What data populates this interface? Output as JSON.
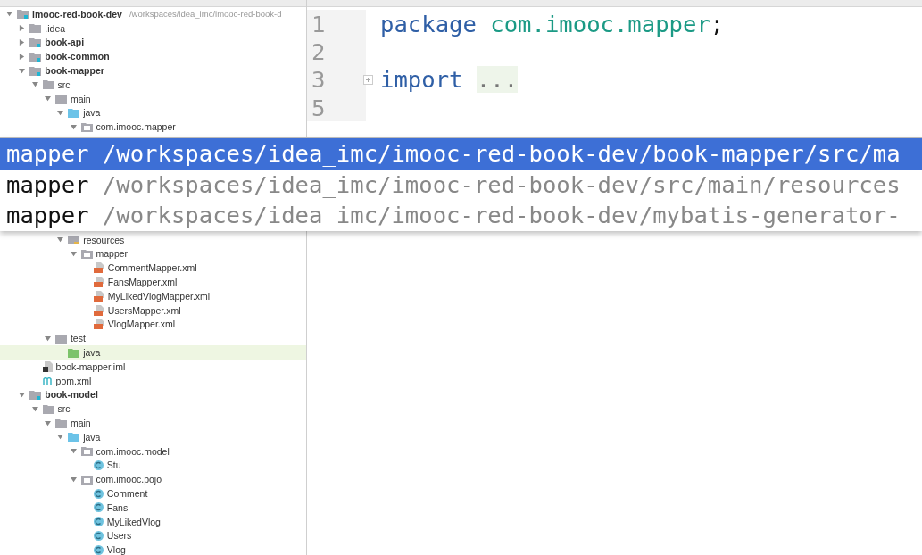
{
  "project_tree": [
    {
      "label": "imooc-red-book-dev",
      "path": "/workspaces/idea_imc/imooc-red-book-d",
      "kind": "module",
      "expanded": true,
      "selected": false,
      "children": [
        {
          "label": ".idea",
          "kind": "folder",
          "expanded": false,
          "selected": false
        },
        {
          "label": "book-api",
          "kind": "module",
          "expanded": false,
          "selected": false
        },
        {
          "label": "book-common",
          "kind": "module",
          "expanded": false,
          "selected": false
        },
        {
          "label": "book-mapper",
          "kind": "module",
          "expanded": true,
          "selected": false,
          "children": [
            {
              "label": "src",
              "kind": "folder",
              "expanded": true,
              "selected": false,
              "children": [
                {
                  "label": "main",
                  "kind": "folder",
                  "expanded": true,
                  "selected": false,
                  "children": [
                    {
                      "label": "java",
                      "kind": "source",
                      "expanded": true,
                      "selected": false,
                      "children": [
                        {
                          "label": "com.imooc.mapper",
                          "kind": "package",
                          "expanded": true,
                          "selected": false
                        }
                      ]
                    },
                    {
                      "label": "resources",
                      "kind": "resources",
                      "expanded": true,
                      "selected": false,
                      "children": [
                        {
                          "label": "mapper",
                          "kind": "package",
                          "expanded": true,
                          "selected": false,
                          "children": [
                            {
                              "label": "CommentMapper.xml",
                              "kind": "xml",
                              "selected": false
                            },
                            {
                              "label": "FansMapper.xml",
                              "kind": "xml",
                              "selected": false
                            },
                            {
                              "label": "MyLikedVlogMapper.xml",
                              "kind": "xml",
                              "selected": false
                            },
                            {
                              "label": "UsersMapper.xml",
                              "kind": "xml",
                              "selected": false
                            },
                            {
                              "label": "VlogMapper.xml",
                              "kind": "xml",
                              "selected": false
                            }
                          ]
                        }
                      ]
                    }
                  ]
                },
                {
                  "label": "test",
                  "kind": "folder",
                  "expanded": true,
                  "selected": false,
                  "children": [
                    {
                      "label": "java",
                      "kind": "test-source",
                      "selected": true
                    }
                  ]
                }
              ]
            },
            {
              "label": "book-mapper.iml",
              "kind": "iml",
              "selected": false
            },
            {
              "label": "pom.xml",
              "kind": "pom",
              "selected": false
            }
          ]
        },
        {
          "label": "book-model",
          "kind": "module",
          "expanded": true,
          "selected": false,
          "children": [
            {
              "label": "src",
              "kind": "folder",
              "expanded": true,
              "selected": false,
              "children": [
                {
                  "label": "main",
                  "kind": "folder",
                  "expanded": true,
                  "selected": false,
                  "children": [
                    {
                      "label": "java",
                      "kind": "source",
                      "expanded": true,
                      "selected": false,
                      "children": [
                        {
                          "label": "com.imooc.model",
                          "kind": "package",
                          "expanded": true,
                          "selected": false,
                          "children": [
                            {
                              "label": "Stu",
                              "kind": "class",
                              "selected": false
                            }
                          ]
                        },
                        {
                          "label": "com.imooc.pojo",
                          "kind": "package",
                          "expanded": true,
                          "selected": false,
                          "children": [
                            {
                              "label": "Comment",
                              "kind": "class",
                              "selected": false
                            },
                            {
                              "label": "Fans",
                              "kind": "class",
                              "selected": false
                            },
                            {
                              "label": "MyLikedVlog",
                              "kind": "class",
                              "selected": false
                            },
                            {
                              "label": "Users",
                              "kind": "class",
                              "selected": false
                            },
                            {
                              "label": "Vlog",
                              "kind": "class",
                              "selected": false
                            }
                          ]
                        }
                      ]
                    }
                  ]
                }
              ]
            }
          ]
        }
      ]
    }
  ],
  "editor": {
    "lines": [
      {
        "number": "1",
        "tokens": [
          {
            "kind": "keyword",
            "text": "package"
          },
          {
            "kind": "name",
            "text": "com.imooc.mapper"
          },
          {
            "kind": "punct",
            "text": ";"
          }
        ]
      },
      {
        "number": "2"
      },
      {
        "number": "3",
        "folded": true,
        "tokens": [
          {
            "kind": "keyword",
            "text": "import"
          },
          {
            "kind": "fold",
            "text": "..."
          }
        ]
      },
      {
        "number": "5"
      }
    ]
  },
  "popup": {
    "items": [
      {
        "name": "mapper",
        "path": "/workspaces/idea_imc/imooc-red-book-dev/book-mapper/src/ma",
        "selected": true
      },
      {
        "name": "mapper",
        "path": "/workspaces/idea_imc/imooc-red-book-dev/src/main/resources",
        "selected": false
      },
      {
        "name": "mapper",
        "path": "/workspaces/idea_imc/imooc-red-book-dev/mybatis-generator-",
        "selected": false
      }
    ]
  }
}
